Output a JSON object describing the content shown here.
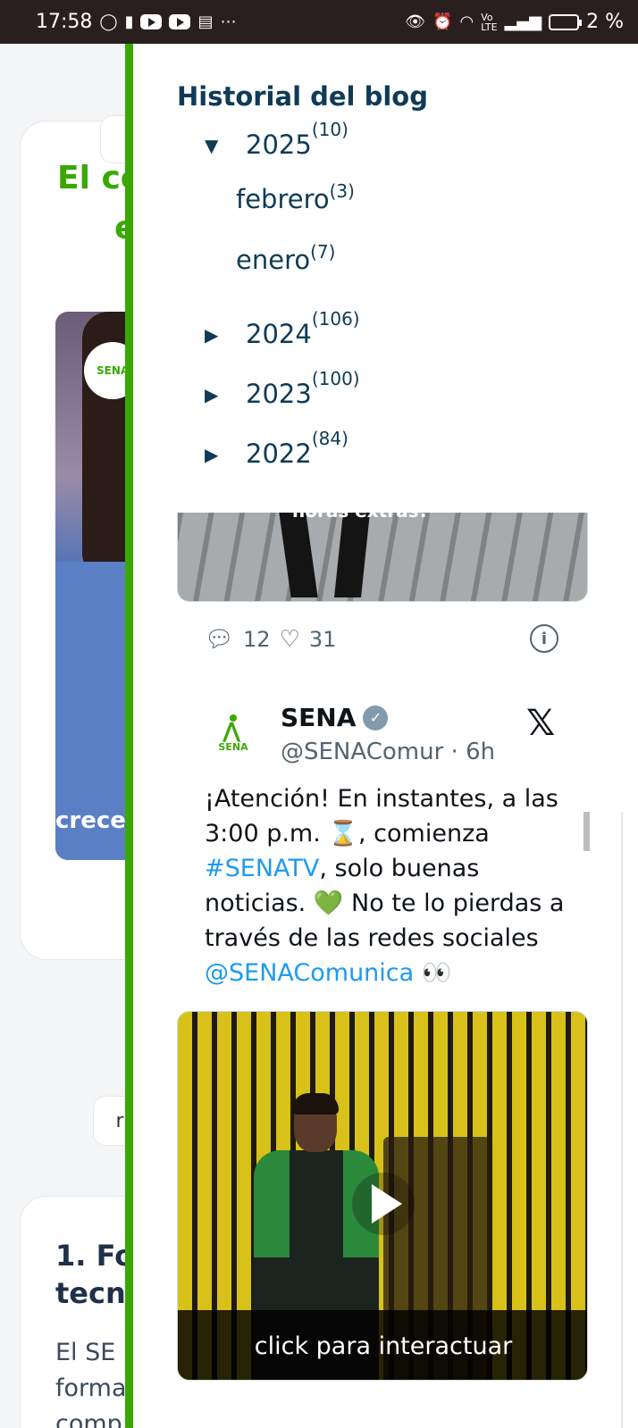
{
  "status_bar": {
    "time": "17:58",
    "battery": "2 %"
  },
  "background_page": {
    "card_title": "El co",
    "card_title_line2": "e",
    "video_caption": "crece",
    "pill_label": "r",
    "section_heading_line1": "1. Fo",
    "section_heading_line2": "tecn",
    "body_line1": "El SE",
    "body_line2": "forma",
    "body_line3": "comp",
    "logo_text": "SENA"
  },
  "archive": {
    "title": "Historial del blog",
    "years": [
      {
        "year": "2025",
        "count": "(10)",
        "expanded": true
      },
      {
        "year": "2024",
        "count": "(106)",
        "expanded": false
      },
      {
        "year": "2023",
        "count": "(100)",
        "expanded": false
      },
      {
        "year": "2022",
        "count": "(84)",
        "expanded": false
      }
    ],
    "months": [
      {
        "name": "febrero",
        "count": "(3)"
      },
      {
        "name": "enero",
        "count": "(7)"
      }
    ]
  },
  "tweet_prev": {
    "image_caption": "horas extras?",
    "replies": "12",
    "likes": "31"
  },
  "tweet": {
    "avatar_text": "SENA",
    "name": "SENA",
    "handle": "@SENAComur",
    "time": "· 6h",
    "text_1": "¡Atención! En instantes, a las 3:00 p.m. ⌛, comienza",
    "hashtag": "#SENATV",
    "text_2": ", solo buenas noticias. 💚 No te lo pierdas a través de las redes sociales",
    "mention": "@SENAComunica",
    "text_3": " 👀",
    "video_overlay": "click para interactuar"
  },
  "colors": {
    "brand_green": "#39a900",
    "archive_text": "#0f3b56",
    "link_blue": "#1d9bf0"
  }
}
